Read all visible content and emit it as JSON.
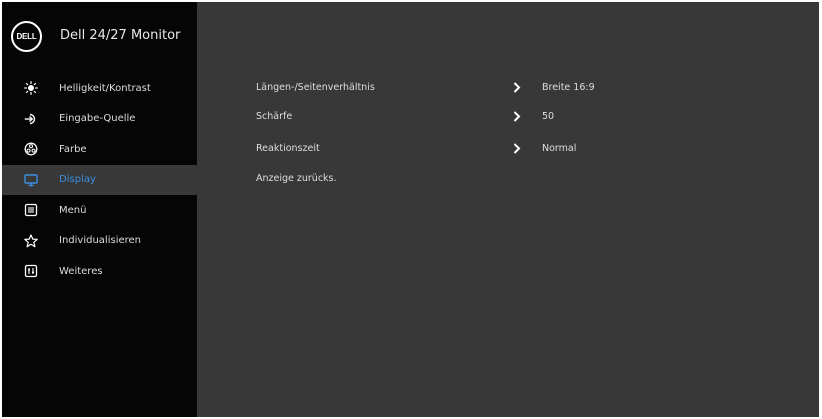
{
  "osd": {
    "brand": {
      "logo_text": "DELL",
      "model_title": "Dell 24/27 Monitor"
    },
    "menu": [
      {
        "label": "Helligkeit/Kontrast",
        "icon": "brightness-icon",
        "active": false
      },
      {
        "label": "Eingabe-Quelle",
        "icon": "input-source-icon",
        "active": false
      },
      {
        "label": "Farbe",
        "icon": "color-palette-icon",
        "active": false
      },
      {
        "label": "Display",
        "icon": "display-icon",
        "active": true
      },
      {
        "label": "Menü",
        "icon": "menu-icon",
        "active": false
      },
      {
        "label": "Individualisieren",
        "icon": "star-icon",
        "active": false
      },
      {
        "label": "Weiteres",
        "icon": "others-icon",
        "active": false
      }
    ],
    "content": {
      "rows": [
        {
          "label": "Längen-/Seitenverhältnis",
          "value": "Breite 16:9",
          "has_chevron": true
        },
        {
          "label": "Schärfe",
          "value": "50",
          "has_chevron": true
        },
        {
          "label": "Reaktionszeit",
          "value": "Normal",
          "has_chevron": true
        },
        {
          "label": "Anzeige zurücks.",
          "value": "",
          "has_chevron": false
        }
      ]
    },
    "colors": {
      "sidebar_background": "#050505",
      "panel_background": "#383838",
      "active_text": "#3b8fe0",
      "text": "#dedede"
    }
  }
}
